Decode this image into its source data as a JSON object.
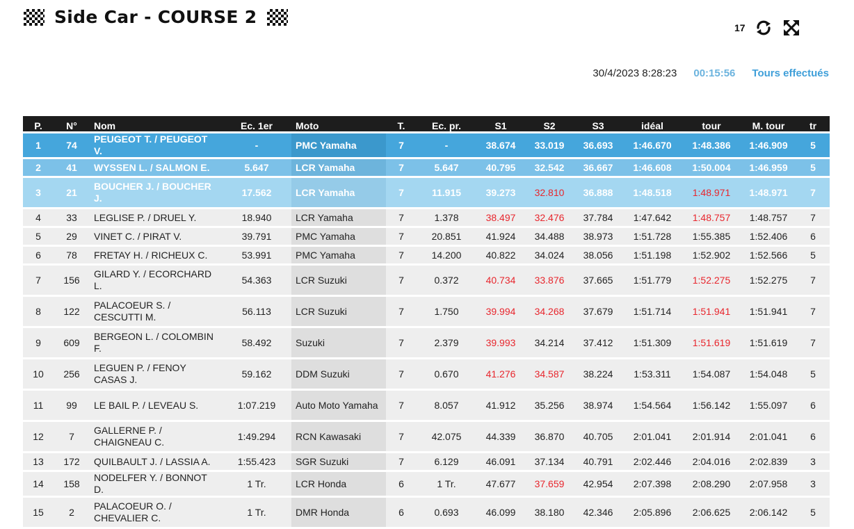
{
  "header": {
    "title": "Side Car - COURSE 2",
    "refresh_count": "17",
    "datetime": "30/4/2023 8:28:23",
    "elapsed": "00:15:56",
    "tours_link": "Tours effectués"
  },
  "colors": {
    "accent_blue": "#3f9fd9",
    "row1": "#45a6dc",
    "row2": "#7cc1e8",
    "row3": "#a4d7f1",
    "best_red": "#e8262d",
    "header_bg": "#1d1d1d"
  },
  "icons": [
    "checkered-flag-icon",
    "refresh-icon",
    "fullscreen-icon"
  ],
  "table": {
    "columns": [
      "P.",
      "N°",
      "Nom",
      "Ec. 1er",
      "Moto",
      "T.",
      "Ec. pr.",
      "S1",
      "S2",
      "S3",
      "idéal",
      "tour",
      "M. tour",
      "tr"
    ],
    "rows": [
      {
        "p": "1",
        "n": "74",
        "nom": "PEUGEOT T. / PEUGEOT V.",
        "ec1": "-",
        "moto": "PMC Yamaha",
        "t": "7",
        "ecpr": "-",
        "s1": "38.674",
        "s2": "33.019",
        "s3": "36.693",
        "ideal": "1:46.670",
        "tour": "1:48.386",
        "mtour": "1:46.909",
        "tr": "5"
      },
      {
        "p": "2",
        "n": "41",
        "nom": "WYSSEN L. / SALMON E.",
        "ec1": "5.647",
        "moto": "LCR Yamaha",
        "t": "7",
        "ecpr": "5.647",
        "s1": "40.795",
        "s2": "32.542",
        "s3": "36.667",
        "ideal": "1:46.608",
        "tour": "1:50.004",
        "mtour": "1:46.959",
        "tr": "5"
      },
      {
        "p": "3",
        "n": "21",
        "nom": "BOUCHER J. / BOUCHER J.",
        "ec1": "17.562",
        "moto": "LCR Yamaha",
        "t": "7",
        "ecpr": "11.915",
        "s1": "39.273",
        "s2": "32.810",
        "s3": "36.888",
        "ideal": "1:48.518",
        "tour": "1:48.971",
        "mtour": "1:48.971",
        "tr": "7"
      },
      {
        "p": "4",
        "n": "33",
        "nom": "LEGLISE P. / DRUEL Y.",
        "ec1": "18.940",
        "moto": "LCR Yamaha",
        "t": "7",
        "ecpr": "1.378",
        "s1": "38.497",
        "s2": "32.476",
        "s3": "37.784",
        "ideal": "1:47.642",
        "tour": "1:48.757",
        "mtour": "1:48.757",
        "tr": "7"
      },
      {
        "p": "5",
        "n": "29",
        "nom": "VINET C. / PIRAT V.",
        "ec1": "39.791",
        "moto": "PMC Yamaha",
        "t": "7",
        "ecpr": "20.851",
        "s1": "41.924",
        "s2": "34.488",
        "s3": "38.973",
        "ideal": "1:51.728",
        "tour": "1:55.385",
        "mtour": "1:52.406",
        "tr": "6"
      },
      {
        "p": "6",
        "n": "78",
        "nom": "FRETAY H. / RICHEUX C.",
        "ec1": "53.991",
        "moto": "PMC Yamaha",
        "t": "7",
        "ecpr": "14.200",
        "s1": "40.822",
        "s2": "34.024",
        "s3": "38.056",
        "ideal": "1:51.198",
        "tour": "1:52.902",
        "mtour": "1:52.566",
        "tr": "5"
      },
      {
        "p": "7",
        "n": "156",
        "nom": "GILARD Y. / ECORCHARD L.",
        "ec1": "54.363",
        "moto": "LCR Suzuki",
        "t": "7",
        "ecpr": "0.372",
        "s1": "40.734",
        "s2": "33.876",
        "s3": "37.665",
        "ideal": "1:51.779",
        "tour": "1:52.275",
        "mtour": "1:52.275",
        "tr": "7"
      },
      {
        "p": "8",
        "n": "122",
        "nom": "PALACOEUR S. / CESCUTTI M.",
        "ec1": "56.113",
        "moto": "LCR Suzuki",
        "t": "7",
        "ecpr": "1.750",
        "s1": "39.994",
        "s2": "34.268",
        "s3": "37.679",
        "ideal": "1:51.714",
        "tour": "1:51.941",
        "mtour": "1:51.941",
        "tr": "7"
      },
      {
        "p": "9",
        "n": "609",
        "nom": "BERGEON L. / COLOMBIN F.",
        "ec1": "58.492",
        "moto": "Suzuki",
        "t": "7",
        "ecpr": "2.379",
        "s1": "39.993",
        "s2": "34.214",
        "s3": "37.412",
        "ideal": "1:51.309",
        "tour": "1:51.619",
        "mtour": "1:51.619",
        "tr": "7"
      },
      {
        "p": "10",
        "n": "256",
        "nom": "LEGUEN P. / FENOY CASAS J.",
        "ec1": "59.162",
        "moto": "DDM Suzuki",
        "t": "7",
        "ecpr": "0.670",
        "s1": "41.276",
        "s2": "34.587",
        "s3": "38.224",
        "ideal": "1:53.311",
        "tour": "1:54.087",
        "mtour": "1:54.048",
        "tr": "5"
      },
      {
        "p": "11",
        "n": "99",
        "nom": "LE BAIL P. / LEVEAU S.",
        "ec1": "1:07.219",
        "moto": "Auto Moto Yamaha",
        "t": "7",
        "ecpr": "8.057",
        "s1": "41.912",
        "s2": "35.256",
        "s3": "38.974",
        "ideal": "1:54.564",
        "tour": "1:56.142",
        "mtour": "1:55.097",
        "tr": "6"
      },
      {
        "p": "12",
        "n": "7",
        "nom": "GALLERNE P. / CHAIGNEAU C.",
        "ec1": "1:49.294",
        "moto": "RCN Kawasaki",
        "t": "7",
        "ecpr": "42.075",
        "s1": "44.339",
        "s2": "36.870",
        "s3": "40.705",
        "ideal": "2:01.041",
        "tour": "2:01.914",
        "mtour": "2:01.041",
        "tr": "6"
      },
      {
        "p": "13",
        "n": "172",
        "nom": "QUILBAULT J. / LASSIA A.",
        "ec1": "1:55.423",
        "moto": "SGR Suzuki",
        "t": "7",
        "ecpr": "6.129",
        "s1": "46.091",
        "s2": "37.134",
        "s3": "40.791",
        "ideal": "2:02.446",
        "tour": "2:04.016",
        "mtour": "2:02.839",
        "tr": "3"
      },
      {
        "p": "14",
        "n": "158",
        "nom": "NODELFER Y. / BONNOT D.",
        "ec1": "1 Tr.",
        "moto": "LCR Honda",
        "t": "6",
        "ecpr": "1 Tr.",
        "s1": "47.677",
        "s2": "37.659",
        "s3": "42.954",
        "ideal": "2:07.398",
        "tour": "2:08.290",
        "mtour": "2:07.958",
        "tr": "3"
      },
      {
        "p": "15",
        "n": "2",
        "nom": "PALACOEUR O. / CHEVALIER C.",
        "ec1": "1 Tr.",
        "moto": "DMR Honda",
        "t": "6",
        "ecpr": "0.693",
        "s1": "46.099",
        "s2": "38.180",
        "s3": "42.346",
        "ideal": "2:05.896",
        "tour": "2:06.625",
        "mtour": "2:06.142",
        "tr": "5"
      }
    ]
  }
}
